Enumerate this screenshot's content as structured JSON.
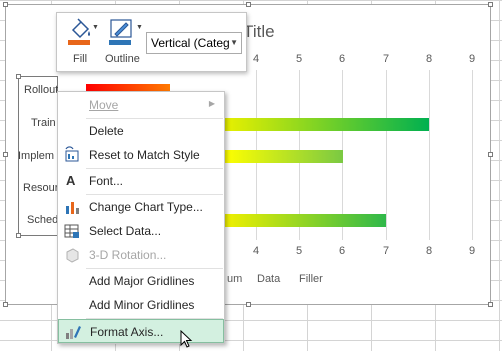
{
  "chart": {
    "title_fragment": "t Title",
    "axis_ticks": [
      "4",
      "6",
      "8",
      "9"
    ],
    "top_tick_labels": [
      "4",
      "5",
      "6",
      "7",
      "8",
      "9"
    ],
    "bottom_tick_labels": [
      "4",
      "5",
      "6",
      "7",
      "8",
      "9"
    ],
    "categories": [
      "Rollout",
      "Train",
      "Implem",
      "Resour",
      "Sched"
    ],
    "legend": [
      "um",
      "Data",
      "Filler"
    ]
  },
  "chart_data": {
    "type": "bar",
    "categories": [
      "Rollout",
      "Training",
      "Implementation",
      "Resources",
      "Schedule"
    ],
    "series": [
      {
        "values": [
          2,
          8,
          6,
          null,
          7
        ]
      }
    ],
    "xlim": [
      0,
      9
    ],
    "title": "t Title",
    "legend_entries": [
      "um",
      "Data",
      "Filler"
    ],
    "grid": true
  },
  "mini_toolbar": {
    "fill_label": "Fill",
    "outline_label": "Outline",
    "selection_value": "Vertical (Categ"
  },
  "context_menu": {
    "items": [
      {
        "label": "Move",
        "disabled": true
      },
      {
        "label": "Delete"
      },
      {
        "label": "Reset to Match Style"
      },
      {
        "label": "Font..."
      },
      {
        "label": "Change Chart Type..."
      },
      {
        "label": "Select Data..."
      },
      {
        "label": "3-D Rotation...",
        "disabled": true
      },
      {
        "label": "Add Major Gridlines"
      },
      {
        "label": "Add Minor Gridlines"
      },
      {
        "label": "Format Axis..."
      }
    ]
  },
  "colors": {
    "gradient_start": "#ff0000",
    "gradient_mid": "#ffff00",
    "gradient_end": "#00b050",
    "menu_highlight": "#d3f0e0"
  }
}
